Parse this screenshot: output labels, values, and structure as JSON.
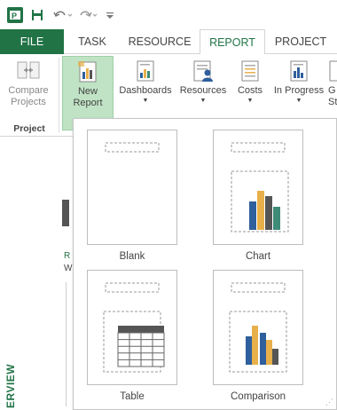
{
  "qat": {
    "app_icon": "project-app-icon",
    "save_icon": "save-icon",
    "undo_icon": "undo-icon",
    "redo_icon": "redo-icon",
    "customize_icon": "customize-qat-icon"
  },
  "tabs": [
    {
      "label": "FILE"
    },
    {
      "label": "TASK"
    },
    {
      "label": "RESOURCE"
    },
    {
      "label": "REPORT"
    },
    {
      "label": "PROJECT"
    }
  ],
  "ribbon": {
    "compare": {
      "line1": "Compare",
      "line2": "Projects"
    },
    "new_report": {
      "line1": "New",
      "line2": "Report"
    },
    "dashboards": {
      "label": "Dashboards"
    },
    "resources": {
      "label": "Resources"
    },
    "costs": {
      "label": "Costs"
    },
    "in_progress": {
      "label": "In Progress"
    },
    "cut_label": {
      "line1": "G",
      "line2": "St"
    },
    "group_label": "Project"
  },
  "side": {
    "letter_r": "R",
    "letter_w": "W",
    "view_label": "ERVIEW"
  },
  "gallery": {
    "items": [
      {
        "label": "Blank"
      },
      {
        "label": "Chart"
      },
      {
        "label": "Table"
      },
      {
        "label": "Comparison"
      }
    ]
  },
  "colors": {
    "accent": "#217346",
    "selected_button": "#bfe3c4",
    "chart_blue": "#2f5f9c",
    "chart_orange": "#e8b04a",
    "chart_gray": "#555555",
    "chart_teal": "#3e8b78"
  }
}
